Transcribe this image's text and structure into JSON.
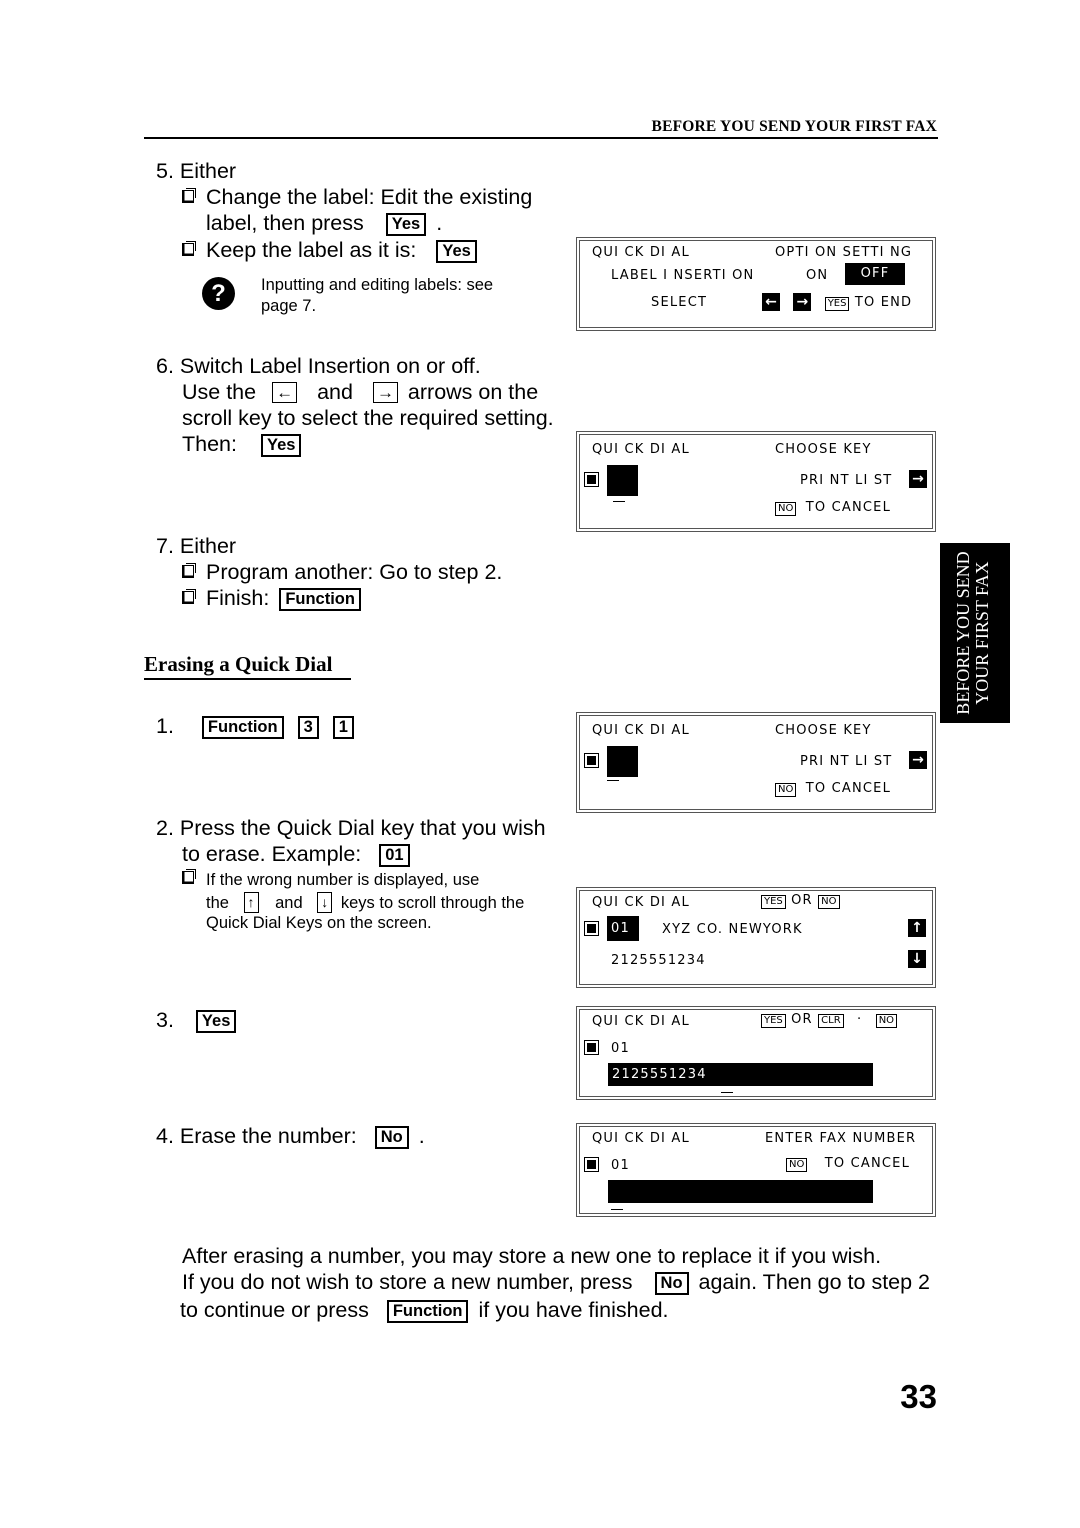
{
  "header": {
    "title": "BEFORE YOU SEND YOUR FIRST FAX"
  },
  "side_tab": {
    "line1": "BEFORE YOU SEND",
    "line2": "YOUR FIRST FAX"
  },
  "step5": {
    "title": "5. Either",
    "opt1_a": "Change the label: Edit the existing",
    "opt1_b": "label, then press",
    "opt1_key": "Yes",
    "opt1_end": ".",
    "opt2": "Keep the label as it is:",
    "opt2_key": "Yes",
    "help_icon": "?",
    "help_a": "Inputting and editing labels: see",
    "help_b": "page 7."
  },
  "step6": {
    "line1": "6. Switch Label Insertion  on or off.",
    "line2_a": "Use the",
    "left_key": "←",
    "line2_b": "and",
    "right_key": "→",
    "line2_c": "arrows on the",
    "line3": "scroll key to select the required setting.",
    "line4": "Then:",
    "key": "Yes"
  },
  "step7": {
    "title": "7. Either",
    "opt1": "Program another: Go to step 2.",
    "opt2": "Finish:",
    "opt2_key": "Function"
  },
  "section": {
    "title": "Erasing a Quick Dial"
  },
  "erase": {
    "s1_num": "1.",
    "s1_keys": [
      "Function",
      "3",
      "1"
    ],
    "s2_a": "2. Press the Quick Dial key that you wish",
    "s2_b": "to erase. Example:",
    "s2_key": "01",
    "s2_note_a": "If the wrong number is displayed, use",
    "s2_note_b1": "the",
    "up_key": "↑",
    "s2_note_b2": "and",
    "down_key": "↓",
    "s2_note_b3": "keys to scroll through the",
    "s2_note_c": "Quick Dial Keys on the screen.",
    "s3_num": "3.",
    "s3_key": "Yes",
    "s4": "4. Erase the number:",
    "s4_key": "No",
    "s4_end": ".",
    "after1": "After erasing a number, you may store a new one to replace it if you wish.",
    "after2_a": "If you do not wish to store a new number, press",
    "after2_key": "No",
    "after2_b": "again. Then go to step 2",
    "after3_a": "to continue or press",
    "after3_key": "Function",
    "after3_b": "if you have finished."
  },
  "lcd1": {
    "title": "QUI CK DI AL",
    "right": "OPTI ON SETTI NG",
    "label": "LABEL I NSERTI ON",
    "on": "ON",
    "off": "OFF",
    "select": "SELECT",
    "yes": "YES",
    "to_end": "TO END"
  },
  "lcd2": {
    "title": "QUI CK DI AL",
    "right": "CHOOSE KEY",
    "print": "PRI NT LI ST",
    "no": "NO",
    "cancel": "TO CANCEL"
  },
  "lcd3": {
    "title": "QUI CK DI AL",
    "right": "CHOOSE KEY",
    "print": "PRI NT LI ST",
    "no": "NO",
    "cancel": "TO CANCEL"
  },
  "lcd4": {
    "title": "QUI CK DI AL",
    "yes": "YES",
    "or": "OR",
    "no": "NO",
    "code": "01",
    "name": "XYZ CO.  NEWYORK",
    "number": "2125551234"
  },
  "lcd5": {
    "title": "QUI CK DI AL",
    "yes": "YES",
    "or": "OR",
    "clr": "CLR",
    "dot": "·",
    "no": "NO",
    "code": "01",
    "number": "2125551234"
  },
  "lcd6": {
    "title": "QUI CK DI AL",
    "right": "ENTER FAX NUMBER",
    "code": "01",
    "no": "NO",
    "cancel": "TO CANCEL"
  },
  "page_number": "33"
}
